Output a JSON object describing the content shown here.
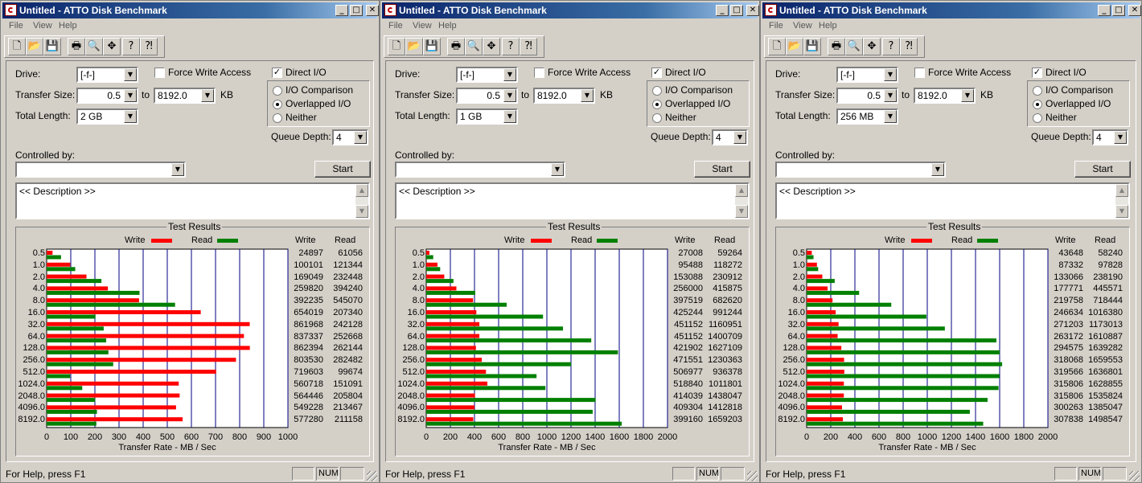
{
  "windows": [
    {
      "title": "Untitled - ATTO Disk Benchmark",
      "menu": [
        "File",
        "View",
        "Help"
      ],
      "drive": {
        "label": "Drive:",
        "value": "[-f-]"
      },
      "force_write_access": {
        "label": "Force Write Access",
        "checked": false
      },
      "direct_io": {
        "label": "Direct I/O",
        "checked": true
      },
      "transfer_size": {
        "label": "Transfer Size:",
        "from": "0.5",
        "to_label": "to",
        "to": "8192.0",
        "unit": "KB"
      },
      "total_length": {
        "label": "Total Length:",
        "value": "2 GB"
      },
      "io_mode": {
        "options": [
          "I/O Comparison",
          "Overlapped I/O",
          "Neither"
        ],
        "selected": 1
      },
      "queue_depth": {
        "label": "Queue Depth:",
        "value": "4"
      },
      "controlled_by": {
        "label": "Controlled by:",
        "value": ""
      },
      "start_label": "Start",
      "description": "<< Description >>",
      "results": {
        "title": "Test Results",
        "legend_write": "Write",
        "legend_read": "Read",
        "col_write": "Write",
        "col_read": "Read",
        "xlabel": "Transfer Rate - MB / Sec",
        "xmax": 1000,
        "ticks": [
          "0",
          "100",
          "200",
          "300",
          "400",
          "500",
          "600",
          "700",
          "800",
          "900",
          "1000"
        ]
      },
      "status_text": "For Help, press F1",
      "status_num": "NUM",
      "chart_data": {
        "type": "bar",
        "categories": [
          "0.5",
          "1.0",
          "2.0",
          "4.0",
          "8.0",
          "16.0",
          "32.0",
          "64.0",
          "128.0",
          "256.0",
          "512.0",
          "1024.0",
          "2048.0",
          "4096.0",
          "8192.0"
        ],
        "series": [
          {
            "name": "Write",
            "color": "#ff0000",
            "values": [
              24897,
              100101,
              169049,
              259820,
              392235,
              654019,
              861968,
              837337,
              862394,
              803530,
              719603,
              560718,
              564446,
              549228,
              577280
            ]
          },
          {
            "name": "Read",
            "color": "#008000",
            "values": [
              61056,
              121344,
              232448,
              394240,
              545070,
              207340,
              242128,
              252668,
              262144,
              282482,
              99674,
              151091,
              205804,
              213467,
              211158
            ]
          }
        ],
        "xlabel": "Transfer Rate - MB / Sec",
        "xlim": [
          0,
          1000
        ]
      }
    },
    {
      "title": "Untitled - ATTO Disk Benchmark",
      "menu": [
        "File",
        "View",
        "Help"
      ],
      "drive": {
        "label": "Drive:",
        "value": "[-f-]"
      },
      "force_write_access": {
        "label": "Force Write Access",
        "checked": false
      },
      "direct_io": {
        "label": "Direct I/O",
        "checked": true
      },
      "transfer_size": {
        "label": "Transfer Size:",
        "from": "0.5",
        "to_label": "to",
        "to": "8192.0",
        "unit": "KB"
      },
      "total_length": {
        "label": "Total Length:",
        "value": "1 GB"
      },
      "io_mode": {
        "options": [
          "I/O Comparison",
          "Overlapped I/O",
          "Neither"
        ],
        "selected": 1
      },
      "queue_depth": {
        "label": "Queue Depth:",
        "value": "4"
      },
      "controlled_by": {
        "label": "Controlled by:",
        "value": ""
      },
      "start_label": "Start",
      "description": "<< Description >>",
      "results": {
        "title": "Test Results",
        "legend_write": "Write",
        "legend_read": "Read",
        "col_write": "Write",
        "col_read": "Read",
        "xlabel": "Transfer Rate - MB / Sec",
        "xmax": 2000,
        "ticks": [
          "0",
          "200",
          "400",
          "600",
          "800",
          "1000",
          "1200",
          "1400",
          "1600",
          "1800",
          "2000"
        ]
      },
      "status_text": "For Help, press F1",
      "status_num": "NUM",
      "chart_data": {
        "type": "bar",
        "categories": [
          "0.5",
          "1.0",
          "2.0",
          "4.0",
          "8.0",
          "16.0",
          "32.0",
          "64.0",
          "128.0",
          "256.0",
          "512.0",
          "1024.0",
          "2048.0",
          "4096.0",
          "8192.0"
        ],
        "series": [
          {
            "name": "Write",
            "color": "#ff0000",
            "values": [
              27008,
              95488,
              153088,
              256000,
              397519,
              425244,
              451152,
              451152,
              421902,
              471551,
              506977,
              518840,
              414039,
              409304,
              399160
            ]
          },
          {
            "name": "Read",
            "color": "#008000",
            "values": [
              59264,
              118272,
              230912,
              415875,
              682620,
              991244,
              1160951,
              1400709,
              1627109,
              1230363,
              936378,
              1011801,
              1438047,
              1412818,
              1659203
            ]
          }
        ],
        "xlabel": "Transfer Rate - MB / Sec",
        "xlim": [
          0,
          2000
        ]
      }
    },
    {
      "title": "Untitled - ATTO Disk Benchmark",
      "menu": [
        "File",
        "View",
        "Help"
      ],
      "drive": {
        "label": "Drive:",
        "value": "[-f-]"
      },
      "force_write_access": {
        "label": "Force Write Access",
        "checked": false
      },
      "direct_io": {
        "label": "Direct I/O",
        "checked": true
      },
      "transfer_size": {
        "label": "Transfer Size:",
        "from": "0.5",
        "to_label": "to",
        "to": "8192.0",
        "unit": "KB"
      },
      "total_length": {
        "label": "Total Length:",
        "value": "256 MB"
      },
      "io_mode": {
        "options": [
          "I/O Comparison",
          "Overlapped I/O",
          "Neither"
        ],
        "selected": 1
      },
      "queue_depth": {
        "label": "Queue Depth:",
        "value": "4"
      },
      "controlled_by": {
        "label": "Controlled by:",
        "value": ""
      },
      "start_label": "Start",
      "description": "<< Description >>",
      "results": {
        "title": "Test Results",
        "legend_write": "Write",
        "legend_read": "Read",
        "col_write": "Write",
        "col_read": "Read",
        "xlabel": "Transfer Rate - MB / Sec",
        "xmax": 2000,
        "ticks": [
          "0",
          "200",
          "400",
          "600",
          "800",
          "1000",
          "1200",
          "1400",
          "1600",
          "1800",
          "2000"
        ]
      },
      "status_text": "For Help, press F1",
      "status_num": "NUM",
      "chart_data": {
        "type": "bar",
        "categories": [
          "0.5",
          "1.0",
          "2.0",
          "4.0",
          "8.0",
          "16.0",
          "32.0",
          "64.0",
          "128.0",
          "256.0",
          "512.0",
          "1024.0",
          "2048.0",
          "4096.0",
          "8192.0"
        ],
        "series": [
          {
            "name": "Write",
            "color": "#ff0000",
            "values": [
              43648,
              87332,
              133066,
              177771,
              219758,
              246634,
              271203,
              263172,
              294575,
              318068,
              319566,
              315806,
              315806,
              300263,
              307838
            ]
          },
          {
            "name": "Read",
            "color": "#008000",
            "values": [
              58240,
              97828,
              238190,
              445571,
              718444,
              1016380,
              1173013,
              1610887,
              1639282,
              1659553,
              1636801,
              1628855,
              1535824,
              1385047,
              1498547
            ]
          }
        ],
        "xlabel": "Transfer Rate - MB / Sec",
        "xlim": [
          0,
          2000
        ]
      }
    }
  ]
}
